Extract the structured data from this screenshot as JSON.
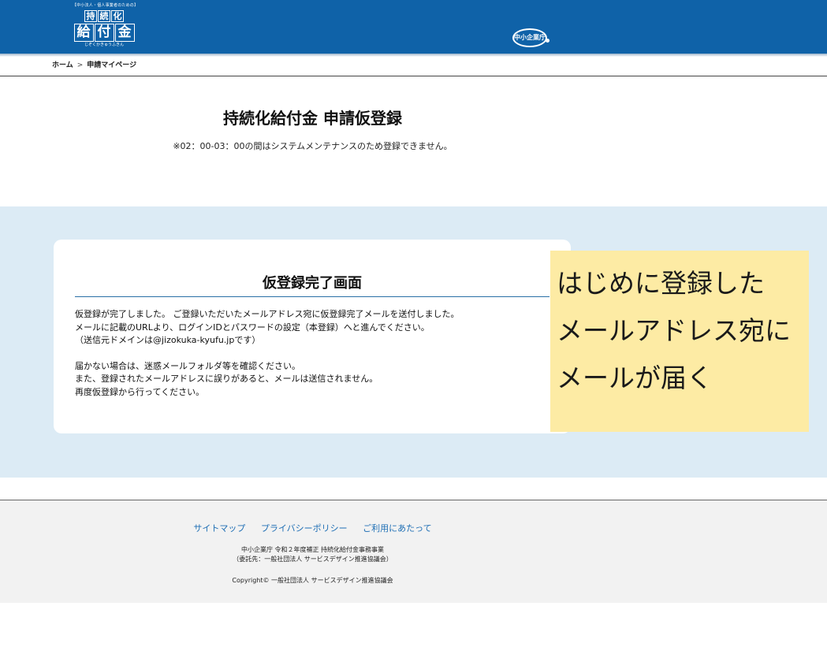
{
  "header": {
    "logo": {
      "tagline": "【中小法人・個人事業者のための】",
      "title_top": [
        "持",
        "続",
        "化"
      ],
      "title_main": [
        "給",
        "付",
        "金"
      ],
      "ruby": "じぞくかきゅうふきん"
    },
    "agency_logo": "中小企業庁",
    "background_color": "#0f62a8"
  },
  "breadcrumb": {
    "home": "ホーム",
    "separator": ">",
    "current": "申請マイページ"
  },
  "page": {
    "title": "持続化給付金 申請仮登録",
    "maintenance_notice": "※02：00-03：00の間はシステムメンテナンスのため登録できません。"
  },
  "card": {
    "title": "仮登録完了画面",
    "lines": [
      "仮登録が完了しました。 ご登録いただいたメールアドレス宛に仮登録完了メールを送付しました。",
      "メールに記載のURLより、ログインIDとパスワードの設定（本登録）へと進んでください。",
      "（送信元ドメインは@jizokuka-kyufu.jpです）",
      "届かない場合は、迷惑メールフォルダ等を確認ください。",
      "また、登録されたメールアドレスに誤りがあると、メールは送信されません。",
      "再度仮登録から行ってください。"
    ]
  },
  "annotation": {
    "lines": [
      "はじめに登録した",
      "メールアドレス宛に",
      "メールが届く"
    ],
    "color": "#fdeba4"
  },
  "footer": {
    "links": [
      "サイトマップ",
      "プライバシーポリシー",
      "ご利用にあたって"
    ],
    "info_line1": "中小企業庁 令和２年度補正 持続化給付金事務事業",
    "info_line2": "（委託先：一般社団法人 サービスデザイン推進協議会）",
    "copyright": "Copyright© 一般社団法人 サービスデザイン推進協議会",
    "link_color": "#1f6fb5"
  }
}
